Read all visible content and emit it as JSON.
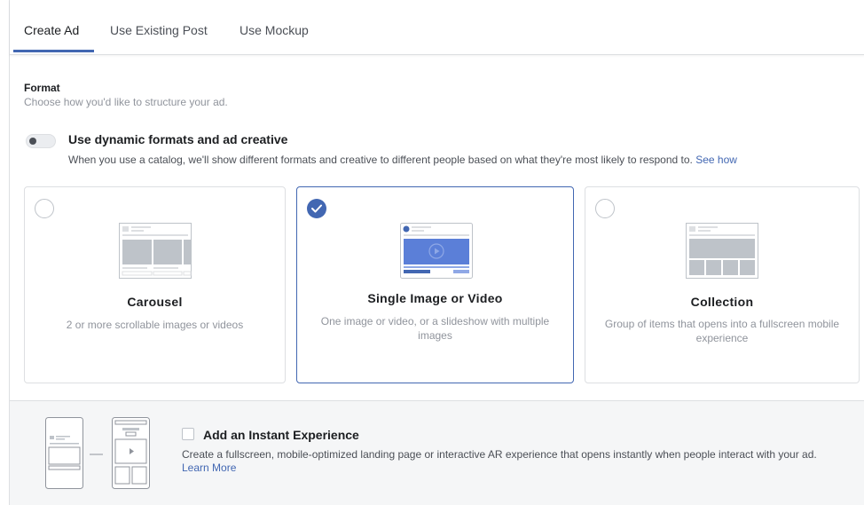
{
  "tabs": [
    {
      "label": "Create Ad",
      "active": true
    },
    {
      "label": "Use Existing Post",
      "active": false
    },
    {
      "label": "Use Mockup",
      "active": false
    }
  ],
  "format": {
    "title": "Format",
    "subtitle": "Choose how you'd like to structure your ad."
  },
  "dynamic": {
    "enabled": false,
    "title": "Use dynamic formats and ad creative",
    "description": "When you use a catalog, we'll show different formats and creative to different people based on what they're most likely to respond to.",
    "link": "See how"
  },
  "cards": [
    {
      "name": "Carousel",
      "description": "2 or more scrollable images or videos",
      "selected": false,
      "icon": "carousel-icon"
    },
    {
      "name": "Single Image or Video",
      "description": "One image or video, or a slideshow with multiple images",
      "selected": true,
      "icon": "single-image-video-icon"
    },
    {
      "name": "Collection",
      "description": "Group of items that opens into a fullscreen mobile experience",
      "selected": false,
      "icon": "collection-icon"
    }
  ],
  "instant_experience": {
    "checked": false,
    "title": "Add an Instant Experience",
    "description": "Create a fullscreen, mobile-optimized landing page or interactive AR experience that opens instantly when people interact with your ad.",
    "link": "Learn More",
    "icon": "instant-experience-icon"
  },
  "colors": {
    "accent": "#4267b2",
    "border": "#dddfe2",
    "muted_text": "#90949c",
    "section_bg": "#f5f6f7"
  }
}
